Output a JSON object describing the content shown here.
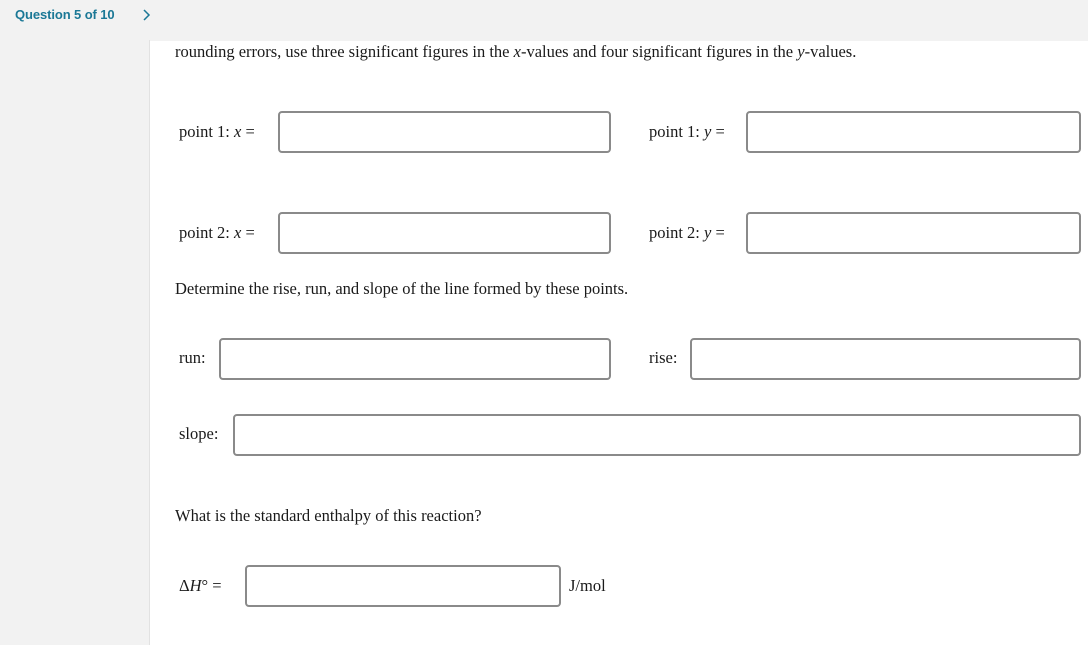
{
  "header": {
    "question_counter": "Question 5 of 10",
    "next_icon": "chevron-right-icon",
    "accent_color": "#1b7896"
  },
  "instructions": {
    "rounding_pre": "rounding errors, use three significant figures in the ",
    "x_var": "x",
    "rounding_mid": "-values and four significant figures in the ",
    "y_var": "y",
    "rounding_post": "-values."
  },
  "points": {
    "p1x": {
      "label_prefix": "point 1: ",
      "var": "x",
      "eq": " =",
      "value": "",
      "placeholder": ""
    },
    "p1y": {
      "label_prefix": "point 1: ",
      "var": "y",
      "eq": " =",
      "value": "",
      "placeholder": ""
    },
    "p2x": {
      "label_prefix": "point 2: ",
      "var": "x",
      "eq": " =",
      "value": "",
      "placeholder": ""
    },
    "p2y": {
      "label_prefix": "point 2: ",
      "var": "y",
      "eq": " =",
      "value": "",
      "placeholder": ""
    }
  },
  "slope_section": {
    "prompt": "Determine the rise, run, and slope of the line formed by these points.",
    "run_label": "run:",
    "run_value": "",
    "rise_label": "rise:",
    "rise_value": "",
    "slope_label": "slope:",
    "slope_value": ""
  },
  "enthalpy_section": {
    "prompt": "What is the standard enthalpy of this reaction?",
    "delta": "Δ",
    "var": "H",
    "superscript": "°",
    "eq": " =",
    "value": "",
    "unit": "J/mol"
  }
}
